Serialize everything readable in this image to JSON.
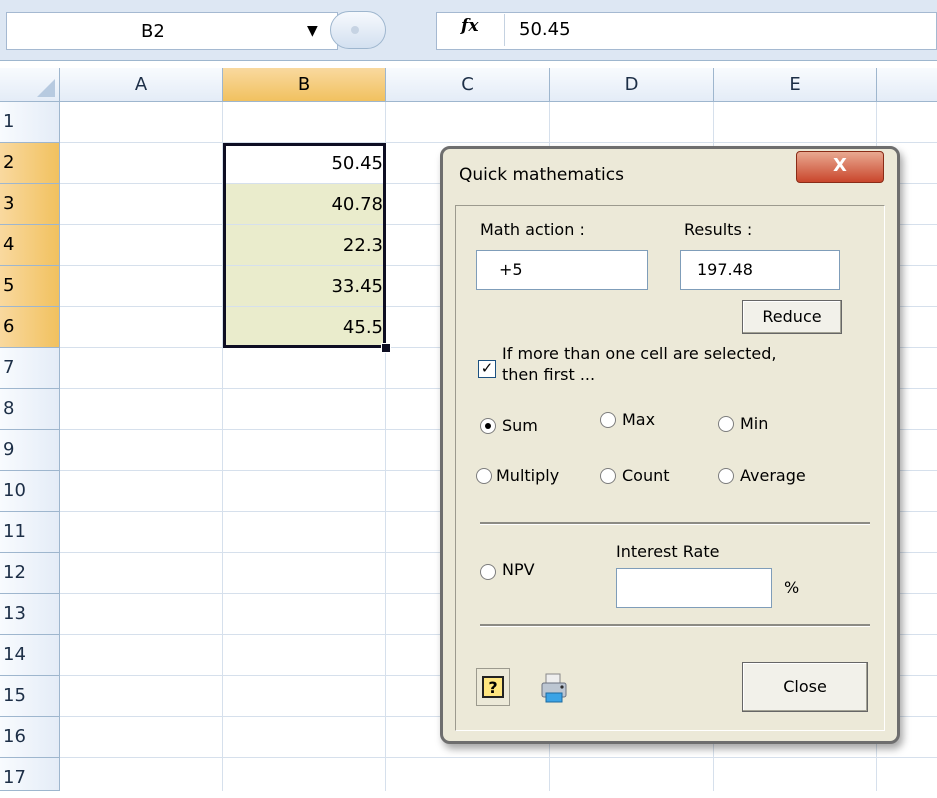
{
  "formula_bar": {
    "name_box": "B2",
    "fx": "fx",
    "formula": "50.45"
  },
  "sheet": {
    "columns": [
      "A",
      "B",
      "C",
      "D",
      "E"
    ],
    "rows": [
      "1",
      "2",
      "3",
      "4",
      "5",
      "6",
      "7",
      "8",
      "9",
      "10",
      "11",
      "12",
      "13",
      "14",
      "15",
      "16",
      "17"
    ],
    "active_column": "B",
    "active_rows": [
      "2",
      "3",
      "4",
      "5",
      "6"
    ],
    "cells_b": [
      "50.45",
      "40.78",
      "22.3",
      "33.45",
      "45.5"
    ]
  },
  "dialog": {
    "title": "Quick mathematics",
    "close_glyph": "X",
    "math_action_label": "Math action :",
    "math_action_value": "+5",
    "results_label": "Results :",
    "results_value": "197.48",
    "reduce_button": "Reduce",
    "checkbox_label_line1": "If more than one cell are selected,",
    "checkbox_label_line2": "then first ...",
    "checkbox_checked": true,
    "radio_options": [
      "Sum",
      "Max",
      "Min",
      "Multiply",
      "Count",
      "Average"
    ],
    "radio_selected": "Sum",
    "npv_label": "NPV",
    "interest_rate_label": "Interest Rate",
    "interest_rate_value": "",
    "percent_sign": "%",
    "close_button": "Close",
    "help_icon": "question-mark",
    "print_icon": "printer"
  }
}
